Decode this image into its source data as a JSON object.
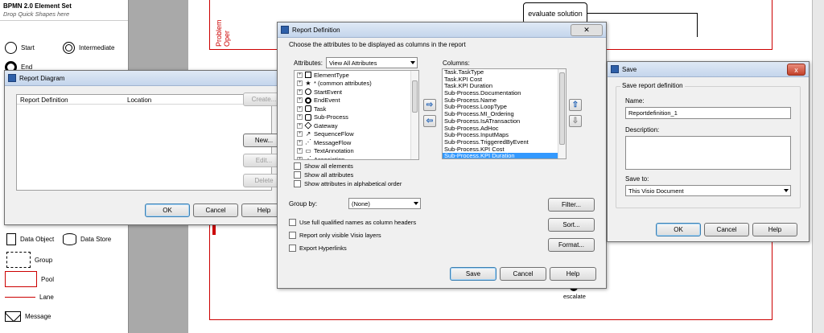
{
  "stencil": {
    "title": "BPMN 2.0 Element Set",
    "hint": "Drop Quick Shapes here",
    "shapes": {
      "start": "Start",
      "intermediate": "Intermediate",
      "end": "End",
      "data_object": "Data Object",
      "data_store": "Data Store",
      "group": "Group",
      "pool": "Pool",
      "lane": "Lane",
      "message": "Message"
    }
  },
  "canvas": {
    "pool_label": "Problem Oper",
    "task": "evaluate solution",
    "event": "escalate"
  },
  "report_diagram": {
    "title": "Report Diagram",
    "col_definition": "Report Definition",
    "col_location": "Location",
    "create": "Create...",
    "new": "New...",
    "edit": "Edit...",
    "delete": "Delete",
    "ok": "OK",
    "cancel": "Cancel",
    "help": "Help"
  },
  "report_definition": {
    "title": "Report Definition",
    "instruction": "Choose the attributes to be displayed as columns in the report",
    "attributes_label": "Attributes:",
    "attributes_filter": "View All Attributes",
    "columns_label": "Columns:",
    "tree": [
      {
        "label": "ElementType",
        "icon": "element-type-icon"
      },
      {
        "label": "* (common attributes)",
        "icon": "star-icon"
      },
      {
        "label": "StartEvent",
        "icon": "start-event-icon"
      },
      {
        "label": "EndEvent",
        "icon": "end-event-icon"
      },
      {
        "label": "Task",
        "icon": "task-icon"
      },
      {
        "label": "Sub-Process",
        "icon": "subprocess-icon"
      },
      {
        "label": "Gateway",
        "icon": "gateway-icon"
      },
      {
        "label": "SequenceFlow",
        "icon": "sequence-flow-icon"
      },
      {
        "label": "MessageFlow",
        "icon": "message-flow-icon"
      },
      {
        "label": "TextAnnotation",
        "icon": "text-annotation-icon"
      },
      {
        "label": "Association",
        "icon": "association-icon"
      }
    ],
    "columns": [
      "Task.TaskType",
      "Task.KPI Cost",
      "Task.KPI Duration",
      "Sub-Process.Documentation",
      "Sub-Process.Name",
      "Sub-Process.LoopType",
      "Sub-Process.MI_Ordering",
      "Sub-Process.IsATransaction",
      "Sub-Process.AdHoc",
      "Sub-Process.InputMaps",
      "Sub-Process.TriggeredByEvent",
      "Sub-Process.KPI Cost",
      "Sub-Process.KPI Duration"
    ],
    "selected_column": 12,
    "show_all_elements": "Show all elements",
    "show_all_attributes": "Show all attributes",
    "show_alpha": "Show attributes in alphabetical order",
    "group_by_label": "Group by:",
    "group_by_value": "(None)",
    "filter": "Filter...",
    "sort": "Sort...",
    "format": "Format...",
    "full_names": "Use full qualified names as column headers",
    "visible_layers": "Report only visible Visio layers",
    "export_hyperlinks": "Export Hyperlinks",
    "save": "Save",
    "cancel": "Cancel",
    "help": "Help"
  },
  "save_dialog": {
    "title": "Save",
    "group_label": "Save report definition",
    "name_label": "Name:",
    "name_value": "Reportdefinition_1",
    "description_label": "Description:",
    "save_to_label": "Save to:",
    "save_to_value": "This Visio Document",
    "ok": "OK",
    "cancel": "Cancel",
    "help": "Help",
    "close": "x"
  },
  "colors": {
    "accent_select": "#3399ff",
    "pool_red": "#cc0000"
  }
}
